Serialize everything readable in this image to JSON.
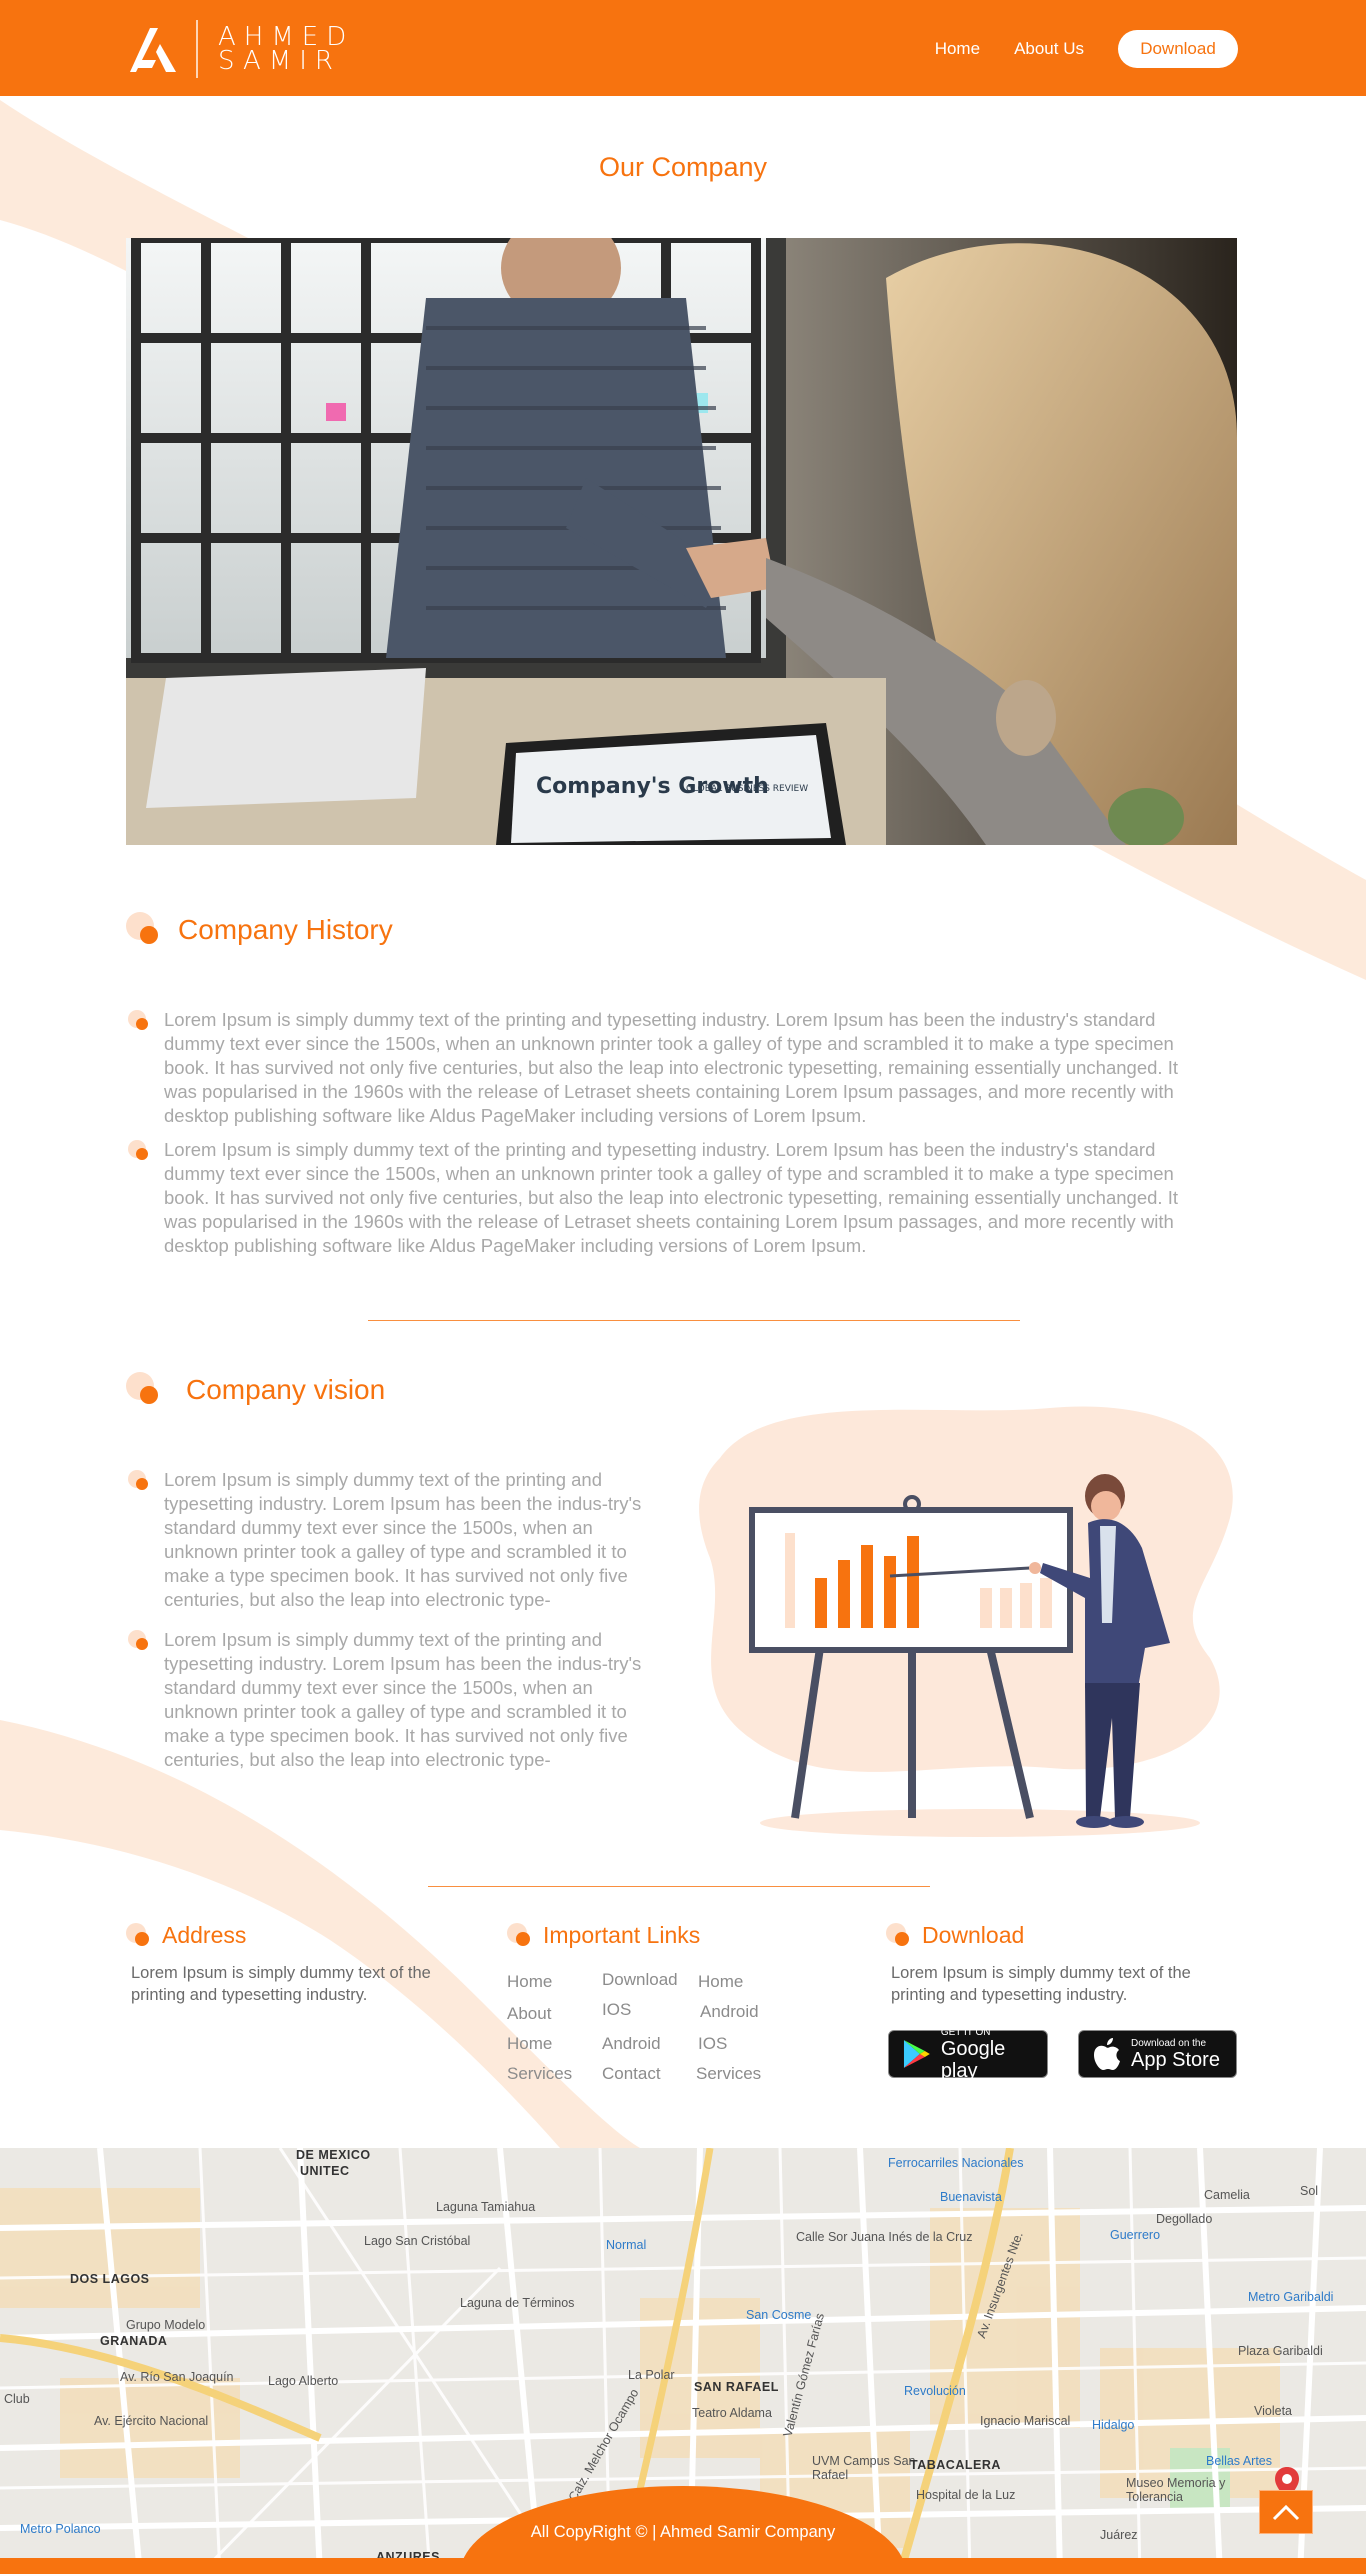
{
  "header": {
    "logo_line1": "AHMED",
    "logo_line2": "SAMIR",
    "nav": [
      "Home",
      "About Us"
    ],
    "download_button": "Download"
  },
  "page_title": "Our Company",
  "hero_image": {
    "screen_title": "Company's Growth",
    "screen_subtitle": "GLOBAL BUSINESS REVIEW"
  },
  "history": {
    "title": "Company History",
    "paragraphs": [
      "Lorem Ipsum is simply dummy text of the printing and typesetting industry. Lorem Ipsum has been the industry's standard dummy text ever since the 1500s, when an unknown printer took a galley of type and scrambled it to make a type specimen book. It has survived not only five centuries, but also the leap into electronic typesetting, remaining essentially unchanged. It was popularised in the 1960s with the release of Letraset sheets containing Lorem Ipsum passages, and more recently with desktop publishing software like Aldus PageMaker including versions of Lorem Ipsum.",
      "Lorem Ipsum is simply dummy text of the printing and typesetting industry. Lorem Ipsum has been the industry's standard dummy text ever since the 1500s, when an unknown printer took a galley of type and scrambled it to make a type specimen book. It has survived not only five centuries, but also the leap into electronic typesetting, remaining essentially unchanged. It was popularised in the 1960s with the release of Letraset sheets containing Lorem Ipsum passages, and more recently with desktop publishing software like Aldus PageMaker including versions of Lorem Ipsum."
    ]
  },
  "vision": {
    "title": "Company vision",
    "paragraphs": [
      "Lorem Ipsum is simply dummy text of the printing and typesetting industry. Lorem Ipsum has been the indus-try's standard dummy text ever since the 1500s, when an unknown printer took a galley of type and scrambled it to make a type specimen book. It has survived not only five centuries, but also the leap into electronic type-",
      "Lorem Ipsum is simply dummy text of the printing and typesetting industry. Lorem Ipsum has been the indus-try's standard dummy text ever since the 1500s, when an unknown printer took a galley of type and scrambled it to make a type specimen book. It has survived not only five centuries, but also the leap into electronic type-"
    ]
  },
  "footer": {
    "address": {
      "title": "Address",
      "text": "Lorem Ipsum is simply dummy text of the printing and typesetting industry."
    },
    "links": {
      "title": "Important Links",
      "col1": [
        "Home",
        "About",
        "Home",
        "Services"
      ],
      "col2": [
        "Download",
        "IOS",
        "Android",
        "Contact"
      ],
      "col3": [
        "Home",
        "Android",
        "IOS",
        "Services"
      ]
    },
    "download": {
      "title": "Download",
      "text": "Lorem Ipsum is simply dummy text of the printing and typesetting industry.",
      "google_small": "GET IT ON",
      "google_big": "Google play",
      "apple_small": "Download on the",
      "apple_big": "App Store"
    }
  },
  "map_labels": [
    "DE MEXICO",
    "UNITEC",
    "Laguna Tamiahua",
    "Lago San Cristóbal",
    "DOS LAGOS",
    "Grupo Modelo",
    "GRANADA",
    "Av. Río San Joaquín",
    "Av. Ejército Nacional",
    "Lago Alberto",
    "Normal",
    "Laguna de Términos",
    "Calle Sor Juana Inés de la Cruz",
    "Buenavista",
    "Ferrocarriles Nacionales",
    "Guerrero",
    "Degollado",
    "San Cosme",
    "Revolución",
    "SAN RAFAEL",
    "Teatro Aldama",
    "UVM Campus San Rafael",
    "TABACALERA",
    "Hospital de la Luz",
    "Hidalgo",
    "Bellas Artes",
    "Museo Memoria y Tolerancia",
    "Plaza Garibaldi",
    "Metro Garibaldi",
    "Camelia",
    "Sol",
    "Violeta",
    "Club",
    "Metro Polanco",
    "Av. Insurgentes Nte.",
    "Juárez",
    "La Polar",
    "Ignacio Mariscal",
    "Valentín Gómez Farías",
    "Calz. Melchor Ocampo",
    "ANZURES"
  ],
  "copyright": "All CopyRight © | Ahmed Samir Company",
  "colors": {
    "accent": "#f7730f",
    "accent_light": "#fde0cc",
    "text_muted": "#a8a8a8"
  },
  "icons": [
    "logo-mark-icon",
    "bullet-dot-icon",
    "google-play-icon",
    "apple-icon",
    "chevron-up-icon",
    "map-pin-icon"
  ]
}
